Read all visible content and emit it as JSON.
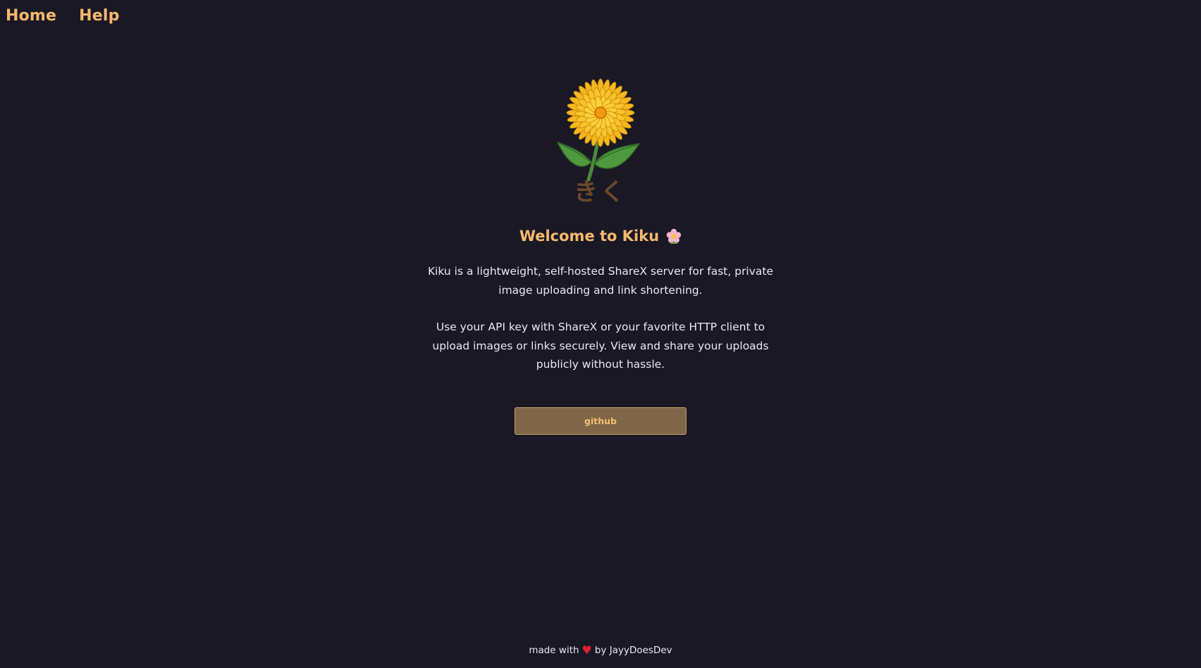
{
  "nav": {
    "items": [
      {
        "label": "Home"
      },
      {
        "label": "Help"
      }
    ]
  },
  "logo": {
    "icon": "chrysanthemum-icon",
    "text": "きく"
  },
  "welcome": {
    "title": "Welcome to Kiku",
    "icon": "flower-emoji-icon"
  },
  "description": {
    "para1": "Kiku is a lightweight, self-hosted ShareX server for fast, private image uploading and link shortening.",
    "para2": "Use your API key with ShareX or your favorite HTTP client to upload images or links securely. View and share your uploads publicly without hassle."
  },
  "button": {
    "label": "github"
  },
  "footer": {
    "prefix": "made with",
    "heart": "♥",
    "suffix": "by JayyDoesDev"
  },
  "colors": {
    "background": "#1b1825",
    "accent": "#f5b96e",
    "text": "#ece7f2",
    "button": "#7f6648",
    "heart": "#e3202f"
  }
}
